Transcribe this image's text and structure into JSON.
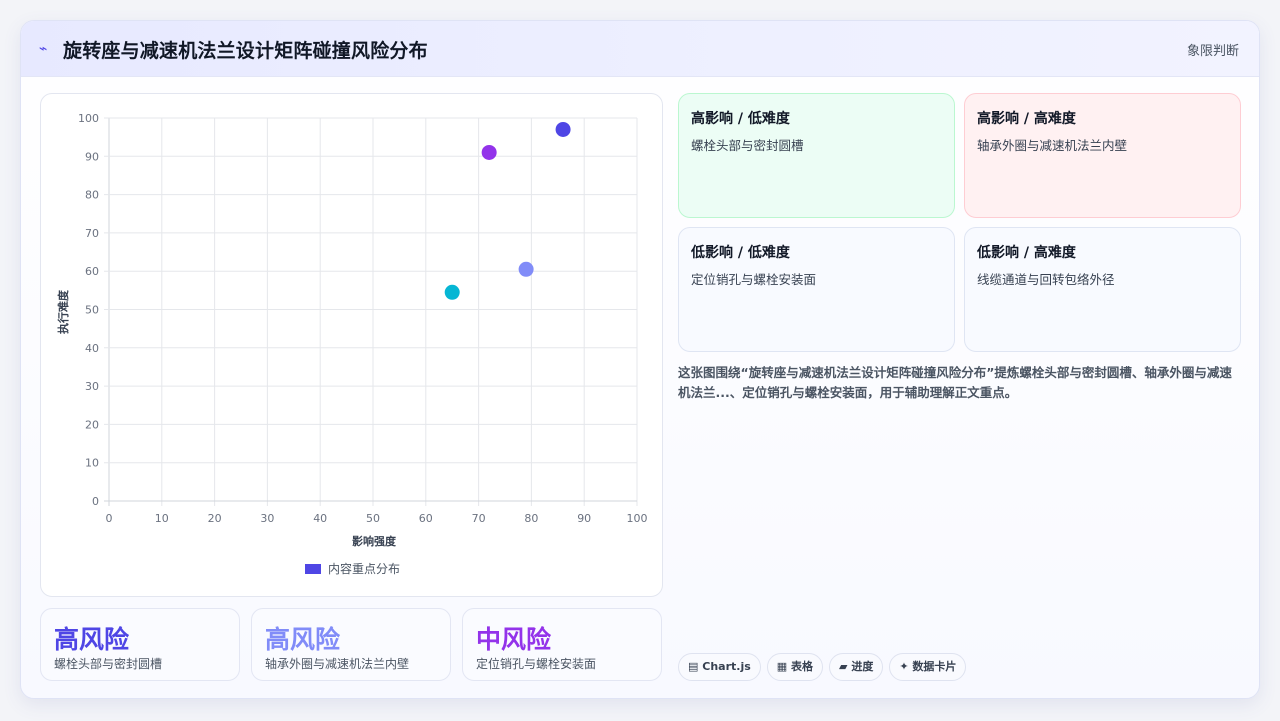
{
  "header": {
    "icon": "lightning-icon",
    "title": "旋转座与减速机法兰设计矩阵碰撞风险分布",
    "tag": "象限判断"
  },
  "chart_data": {
    "type": "scatter",
    "xlabel": "影响强度",
    "ylabel": "执行难度",
    "xlim": [
      0,
      100
    ],
    "ylim": [
      0,
      100
    ],
    "xticks": [
      0,
      10,
      20,
      30,
      40,
      50,
      60,
      70,
      80,
      90,
      100
    ],
    "yticks": [
      0,
      10,
      20,
      30,
      40,
      50,
      60,
      70,
      80,
      90,
      100
    ],
    "grid": true,
    "legend": {
      "position": "bottom",
      "label": "内容重点分布",
      "color": "#4f46e5"
    },
    "points": [
      {
        "x": 86,
        "y": 97,
        "color": "#4f46e5"
      },
      {
        "x": 72,
        "y": 91,
        "color": "#9333ea"
      },
      {
        "x": 79,
        "y": 60.5,
        "color": "#818cf8"
      },
      {
        "x": 65,
        "y": 54.5,
        "color": "#06b6d4"
      }
    ]
  },
  "stats": [
    {
      "level": "高风险",
      "text": "螺栓头部与密封圆槽",
      "color": "#4f46e5"
    },
    {
      "level": "高风险",
      "text": "轴承外圈与减速机法兰内壁",
      "color": "#818cf8"
    },
    {
      "level": "中风险",
      "text": "定位销孔与螺栓安装面",
      "color": "#9333ea"
    }
  ],
  "quadrants": [
    {
      "title": "高影响 / 低难度",
      "body": "螺栓头部与密封圆槽",
      "bg": "#ecfdf5",
      "border": "#bbf7d0"
    },
    {
      "title": "高影响 / 高难度",
      "body": "轴承外圈与减速机法兰内壁",
      "bg": "#fff1f2",
      "border": "#fecdd3"
    },
    {
      "title": "低影响 / 低难度",
      "body": "定位销孔与螺栓安装面",
      "bg": "#f8faff",
      "border": "#dfe5f3"
    },
    {
      "title": "低影响 / 高难度",
      "body": "线缆通道与回转包络外径",
      "bg": "#f8faff",
      "border": "#dfe5f3"
    }
  ],
  "description": "这张图围绕“旋转座与减速机法兰设计矩阵碰撞风险分布”提炼螺栓头部与密封圆槽、轴承外圈与减速机法兰...、定位销孔与螺栓安装面，用于辅助理解正文重点。",
  "chips": [
    {
      "icon": "chart-icon",
      "glyph": "▤",
      "label": "Chart.js"
    },
    {
      "icon": "table-icon",
      "glyph": "▦",
      "label": "表格"
    },
    {
      "icon": "progress-icon",
      "glyph": "▰",
      "label": "进度"
    },
    {
      "icon": "sparkle-icon",
      "glyph": "✦",
      "label": "数据卡片"
    }
  ]
}
